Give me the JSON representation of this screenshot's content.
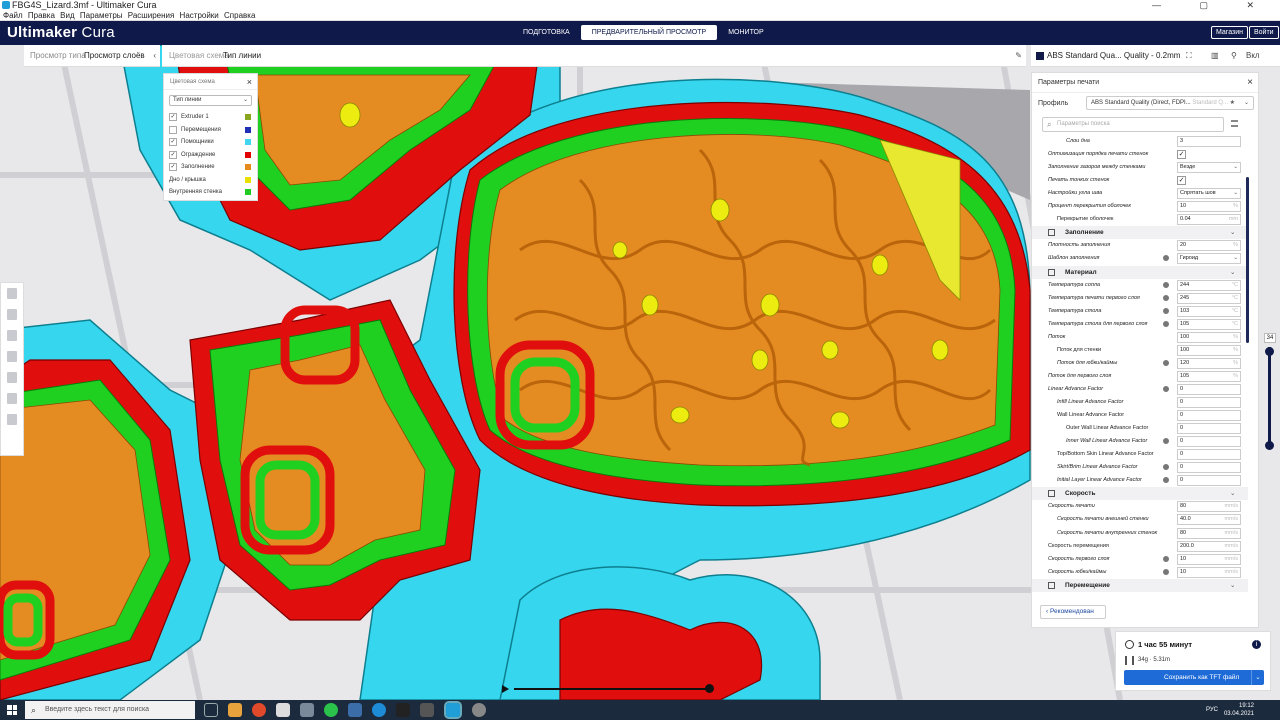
{
  "window": {
    "title": "FBG4S_Lizard.3mf - Ultimaker Cura",
    "controls": "—  ▢  ✕"
  },
  "menu": [
    "Файл",
    "Правка",
    "Вид",
    "Параметры",
    "Расширения",
    "Настройки",
    "Справка"
  ],
  "header": {
    "brand_bold": "Ultimaker",
    "brand_thin": " Cura",
    "stages": [
      "ПОДГОТОВКА",
      "ПРЕДВАРИТЕЛЬНЫЙ ПРОСМОТР",
      "МОНИТОР"
    ],
    "active_stage": 1,
    "marketplace": "Магазин",
    "signin": "Войти"
  },
  "viewbar": {
    "option1": "Просмотр типа",
    "option2": "Просмотр слоёв"
  },
  "schemebar": {
    "label": "Цветовая схема",
    "value": "Тип линии"
  },
  "scheme_panel": {
    "title": "Цветовая схема",
    "select": "Тип линии",
    "items": [
      {
        "label": "Extruder 1",
        "checked": true,
        "color": "#8aa51e"
      },
      {
        "label": "Перемещения",
        "checked": false,
        "color": "#1e2fb5"
      },
      {
        "label": "Помощники",
        "checked": true,
        "color": "#40d7ee"
      },
      {
        "label": "Ограждение",
        "checked": true,
        "color": "#e00000"
      },
      {
        "label": "Заполнение",
        "checked": true,
        "color": "#e68a1e"
      },
      {
        "label": "Дно / крышка",
        "checked": null,
        "color": "#e8e000"
      },
      {
        "label": "Внутренняя стенка",
        "checked": null,
        "color": "#21cc21"
      }
    ]
  },
  "rbar": {
    "profile": "ABS Standard Qua... Quality - 0.2mm",
    "right_label": "Вкл"
  },
  "settings": {
    "title": "Параметры печати",
    "profile_label": "Профиль",
    "profile_value": "ABS Standard Quality (Direct, FDPI...",
    "profile_hint": "Standard Q...",
    "search_placeholder": "Параметры поиска",
    "recommended": "Рекомендован",
    "rows": [
      {
        "label": "Слои дна",
        "indent": 2,
        "value": "3",
        "unit": "",
        "type": "field"
      },
      {
        "label": "Оптимизация порядка печати стенок",
        "indent": 0,
        "type": "check",
        "checked": true
      },
      {
        "label": "Заполнение зазоров между стенками",
        "indent": 0,
        "value": "Везде",
        "type": "select"
      },
      {
        "label": "Печать тонких стенок",
        "indent": 0,
        "type": "check",
        "checked": true
      },
      {
        "label": "Настройки угла шва",
        "indent": 0,
        "value": "Спрятать шов",
        "type": "select"
      },
      {
        "label": "Процент перекрытия оболочек",
        "indent": 0,
        "value": "10",
        "unit": "%",
        "type": "field"
      },
      {
        "label": "Перекрытие оболочек",
        "indent": 1,
        "value": "0.04",
        "unit": "mm",
        "type": "field",
        "italic": false
      },
      {
        "label": "Заполнение",
        "type": "category"
      },
      {
        "label": "Плотность заполнения",
        "indent": 0,
        "value": "20",
        "unit": "%",
        "type": "field"
      },
      {
        "label": "Шаблон заполнения",
        "indent": 0,
        "value": "Гироид",
        "type": "select",
        "icon": true
      },
      {
        "label": "Материал",
        "type": "category"
      },
      {
        "label": "Температура сопла",
        "indent": 0,
        "value": "244",
        "unit": "°C",
        "type": "field",
        "icon": true
      },
      {
        "label": "Температура печати первого слоя",
        "indent": 0,
        "value": "245",
        "unit": "°C",
        "type": "field",
        "icon": true
      },
      {
        "label": "Температура стола",
        "indent": 0,
        "value": "103",
        "unit": "°C",
        "type": "field",
        "icon": true
      },
      {
        "label": "Температура стола для первого слоя",
        "indent": 0,
        "value": "105",
        "unit": "°C",
        "type": "field",
        "icon": true
      },
      {
        "label": "Поток",
        "indent": 0,
        "value": "100",
        "unit": "%",
        "type": "field"
      },
      {
        "label": "Поток для стенки",
        "indent": 1,
        "value": "100",
        "unit": "%",
        "type": "field",
        "italic": false
      },
      {
        "label": "Поток для юбки/каймы",
        "indent": 1,
        "value": "120",
        "unit": "%",
        "type": "field",
        "icon": true
      },
      {
        "label": "Поток для первого слоя",
        "indent": 0,
        "value": "105",
        "unit": "%",
        "type": "field"
      },
      {
        "label": "Linear Advance Factor",
        "indent": 0,
        "value": "0",
        "unit": "",
        "type": "field",
        "icon": true
      },
      {
        "label": "Infill Linear Advance Factor",
        "indent": 1,
        "value": "0",
        "unit": "",
        "type": "field"
      },
      {
        "label": "Wall Linear Advance Factor",
        "indent": 1,
        "value": "0",
        "unit": "",
        "type": "field",
        "italic": false
      },
      {
        "label": "Outer Wall Linear Advance Factor",
        "indent": 2,
        "value": "0",
        "unit": "",
        "type": "field",
        "italic": false
      },
      {
        "label": "Inner Wall Linear Advance Factor",
        "indent": 2,
        "value": "0",
        "unit": "",
        "type": "field",
        "icon": true
      },
      {
        "label": "Top/Bottom Skin Linear Advance Factor",
        "indent": 1,
        "value": "0",
        "unit": "",
        "type": "field",
        "italic": false
      },
      {
        "label": "Skirt/Brim Linear Advance Factor",
        "indent": 1,
        "value": "0",
        "unit": "",
        "type": "field",
        "icon": true
      },
      {
        "label": "Initial Layer Linear Advance Factor",
        "indent": 1,
        "value": "0",
        "unit": "",
        "type": "field",
        "icon": true
      },
      {
        "label": "Скорость",
        "type": "category"
      },
      {
        "label": "Скорость печати",
        "indent": 0,
        "value": "80",
        "unit": "mm/s",
        "type": "field"
      },
      {
        "label": "Скорость печати внешней стенки",
        "indent": 1,
        "value": "40.0",
        "unit": "mm/s",
        "type": "field"
      },
      {
        "label": "Скорость печати внутренних стенок",
        "indent": 1,
        "value": "80",
        "unit": "mm/s",
        "type": "field"
      },
      {
        "label": "Скорость перемещения",
        "indent": 0,
        "value": "200.0",
        "unit": "mm/s",
        "type": "field",
        "italic": false
      },
      {
        "label": "Скорость первого слоя",
        "indent": 0,
        "value": "10",
        "unit": "mm/s",
        "type": "field",
        "icon": true
      },
      {
        "label": "Скорость юбки/каймы",
        "indent": 0,
        "value": "10",
        "unit": "mm/s",
        "type": "field",
        "icon": true
      },
      {
        "label": "Перемещение",
        "type": "category"
      }
    ]
  },
  "layer_slider": {
    "value": "34"
  },
  "print_info": {
    "time": "1 час 55 минут",
    "material": "34g · 5.31m",
    "save": "Сохранить как TFT файл"
  },
  "taskbar": {
    "search": "Введите здесь текст для поиска",
    "lang": "РУС",
    "time": "19:12",
    "date": "03.04.2021"
  }
}
